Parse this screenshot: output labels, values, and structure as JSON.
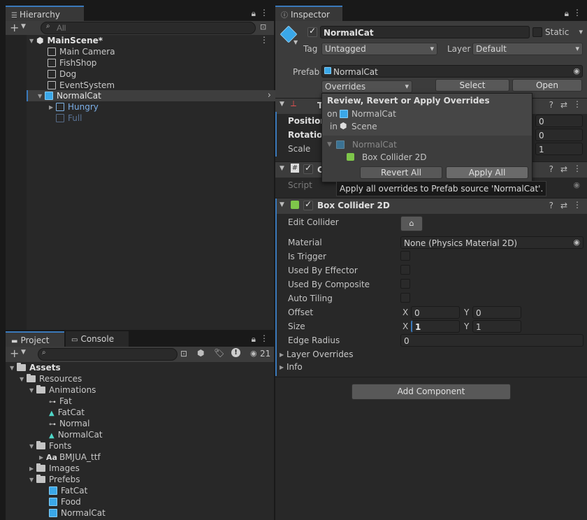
{
  "hierarchy": {
    "tab_label": "Hierarchy",
    "search_placeholder": "All",
    "scene_name": "MainScene*",
    "items": [
      {
        "label": "Main Camera"
      },
      {
        "label": "FishShop"
      },
      {
        "label": "Dog"
      },
      {
        "label": "EventSystem"
      },
      {
        "label": "NormalCat"
      },
      {
        "label": "Hungry"
      },
      {
        "label": "Full"
      }
    ]
  },
  "project": {
    "tabs": [
      "Project",
      "Console"
    ],
    "hidden_count": "21",
    "tree": [
      {
        "label": "Assets"
      },
      {
        "label": "Resources"
      },
      {
        "label": "Animations"
      },
      {
        "label": "Fat"
      },
      {
        "label": "FatCat"
      },
      {
        "label": "Normal"
      },
      {
        "label": "NormalCat"
      },
      {
        "label": "Fonts"
      },
      {
        "label": "BMJUA_ttf"
      },
      {
        "label": "Images"
      },
      {
        "label": "Prefebs"
      },
      {
        "label": "FatCat"
      },
      {
        "label": "Food"
      },
      {
        "label": "NormalCat"
      }
    ]
  },
  "inspector": {
    "tab_label": "Inspector",
    "object_name": "NormalCat",
    "static_label": "Static",
    "tag_label": "Tag",
    "tag_value": "Untagged",
    "layer_label": "Layer",
    "layer_value": "Default",
    "prefab_label": "Prefab",
    "prefab_value": "NormalCat",
    "overrides_label": "Overrides",
    "select_label": "Select",
    "open_label": "Open",
    "transform": {
      "title": "T",
      "position_label": "Position",
      "rotation_label": "Rotation",
      "scale_label": "Scale",
      "position_z": "0",
      "rotation_z": "0",
      "scale_z": "1"
    },
    "script_component": {
      "title": "C",
      "script_label": "Script"
    },
    "box_collider": {
      "title": "Box Collider 2D",
      "edit_collider_label": "Edit Collider",
      "material_label": "Material",
      "material_value": "None (Physics Material 2D)",
      "is_trigger_label": "Is Trigger",
      "used_by_effector_label": "Used By Effector",
      "used_by_composite_label": "Used By Composite",
      "auto_tiling_label": "Auto Tiling",
      "offset_label": "Offset",
      "offset_x": "0",
      "offset_y": "0",
      "size_label": "Size",
      "size_x": "1",
      "size_y": "1",
      "x_label": "X",
      "y_label": "Y",
      "edge_radius_label": "Edge Radius",
      "edge_radius_value": "0",
      "layer_overrides_label": "Layer Overrides",
      "info_label": "Info"
    },
    "add_component_label": "Add Component"
  },
  "overrides_popup": {
    "title": "Review, Revert or Apply Overrides",
    "on_label": "on",
    "on_value": "NormalCat",
    "in_label": "in",
    "in_value": "Scene",
    "tree_root": "NormalCat",
    "tree_child": "Box Collider 2D",
    "revert_all_label": "Revert All",
    "apply_all_label": "Apply All"
  },
  "tooltip": {
    "text": "Apply all overrides to Prefab source 'NormalCat'."
  },
  "colors": {
    "accent": "#3a79bb",
    "prefab_blue": "#3aa7e8",
    "selected_row": "#3e3e3e"
  }
}
